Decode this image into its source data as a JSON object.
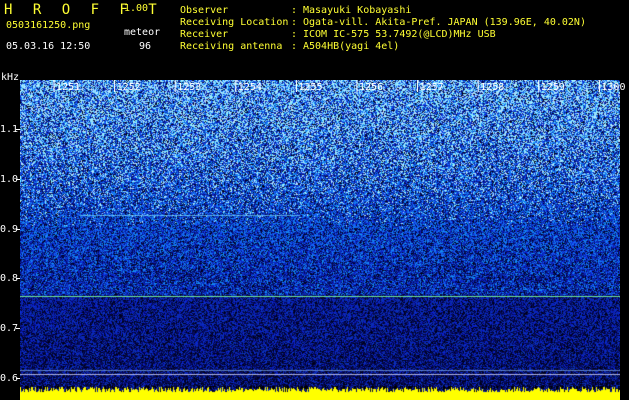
{
  "header": {
    "app_title": "H R O F F T",
    "version": "1.00",
    "file_name": "0503161250.png",
    "mode": "meteor",
    "datetime": "05.03.16 12:50",
    "count": "96",
    "info": [
      {
        "label": "Observer",
        "value": "Masayuki Kobayashi"
      },
      {
        "label": "Receiving Location",
        "value": "Ogata-vill. Akita-Pref. JAPAN (139.96E, 40.02N)"
      },
      {
        "label": "Receiver",
        "value": "ICOM IC-575 53.7492(@LCD)MHz USB"
      },
      {
        "label": "Receiving antenna",
        "value": "A504HB(yagi 4el)"
      }
    ],
    "colon": ":"
  },
  "spectrogram": {
    "unit": "kHz",
    "time_labels": [
      "1251",
      "1252",
      "1253",
      "1254",
      "1255",
      "1256",
      "1257",
      "1258",
      "1259",
      "1300"
    ],
    "freq_labels": [
      "1.1",
      "1.0",
      "0.9",
      "0.8",
      "0.7",
      "0.6"
    ],
    "colors": {
      "background": "#000000",
      "text_yellow": "#ffff33",
      "noise_blue": "#1a3cff",
      "noise_cyan": "#55ddff",
      "line_green": "#7dff9a",
      "baseline_yellow": "#ffff00"
    }
  }
}
